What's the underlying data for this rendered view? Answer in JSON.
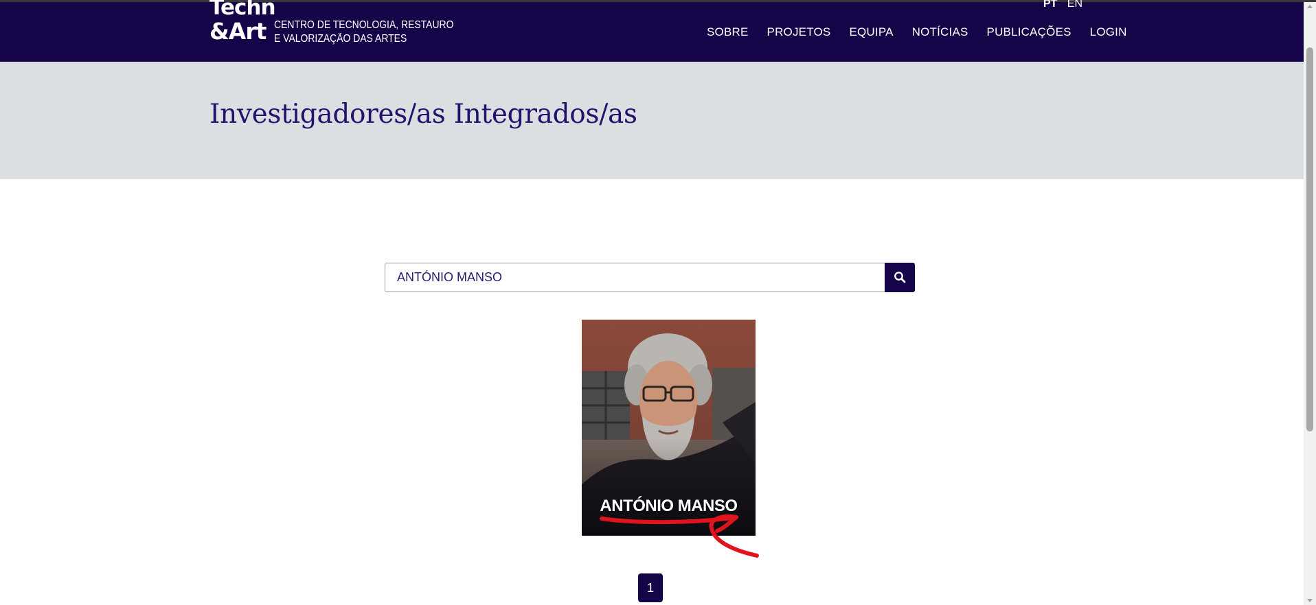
{
  "colors": {
    "header_bg": "#150548",
    "hero_bg": "#dcdfe2",
    "title_color": "#23126d",
    "annotation_red": "#e0141c"
  },
  "header": {
    "logo_line1": "Techn",
    "logo_line2": "&Art",
    "tagline_line1": "CENTRO DE TECNOLOGIA, RESTAURO",
    "tagline_line2": "E VALORIZAÇÃO DAS ARTES",
    "languages": [
      {
        "code": "PT",
        "active": true
      },
      {
        "code": "EN",
        "active": false
      }
    ],
    "nav": [
      {
        "label": "SOBRE"
      },
      {
        "label": "PROJETOS"
      },
      {
        "label": "EQUIPA"
      },
      {
        "label": "NOTÍCIAS"
      },
      {
        "label": "PUBLICAÇÕES"
      },
      {
        "label": "LOGIN"
      }
    ]
  },
  "hero": {
    "title": "Investigadores/as Integrados/as"
  },
  "search": {
    "value": "ANTÓNIO MANSO",
    "button_icon": "search-icon"
  },
  "results": [
    {
      "name": "ANTÓNIO MANSO"
    }
  ],
  "pagination": {
    "current_page": "1"
  }
}
